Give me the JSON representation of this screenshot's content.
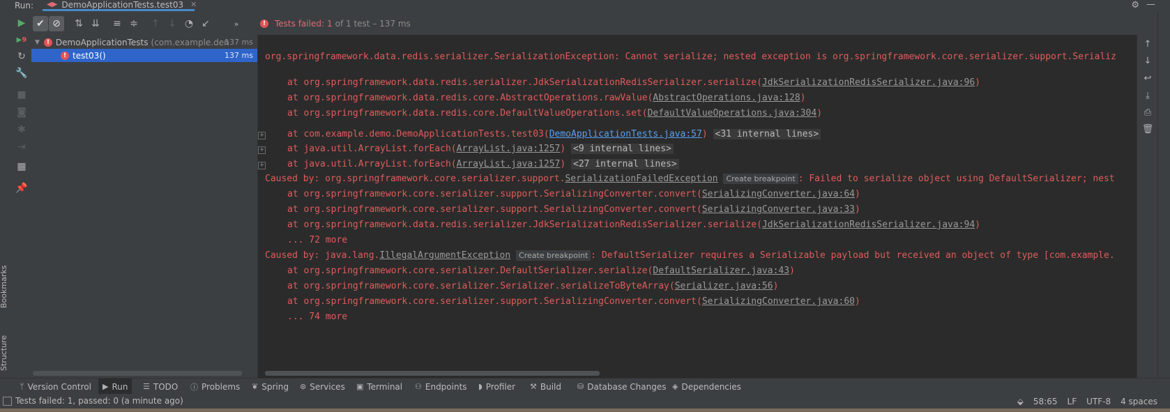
{
  "header": {
    "run_label": "Run:",
    "tab_title": "DemoApplicationTests.test03"
  },
  "status_message": {
    "prefix": "Tests failed:",
    "count": "1",
    "detail": "of 1 test – 137 ms"
  },
  "left_strip": {
    "bookmarks": "Bookmarks",
    "structure": "Structure"
  },
  "run_column": {
    "fail_count": "9"
  },
  "tree": {
    "root": {
      "name": "DemoApplicationTests",
      "package": "(com.example.den",
      "time": "137 ms"
    },
    "child": {
      "name": "test03()",
      "time": "137 ms"
    }
  },
  "console": {
    "line1": "org.springframework.data.redis.serializer.SerializationException: Cannot serialize; nested exception is org.springframework.core.serializer.support.Serializ",
    "l2_pre": "at org.springframework.data.redis.serializer.JdkSerializationRedisSerializer.serialize(",
    "l2_link": "JdkSerializationRedisSerializer.java:96",
    "l2_post": ")",
    "l3_pre": "at org.springframework.data.redis.core.AbstractOperations.rawValue(",
    "l3_link": "AbstractOperations.java:128",
    "l3_post": ")",
    "l4_pre": "at org.springframework.data.redis.core.DefaultValueOperations.set(",
    "l4_link": "DefaultValueOperations.java:304",
    "l4_post": ")",
    "l5_pre": "at com.example.demo.DemoApplicationTests.test03(",
    "l5_link": "DemoApplicationTests.java:57",
    "l5_post": ")",
    "l5_internal": "<31 internal lines>",
    "l6_pre": "at java.util.ArrayList.forEach(",
    "l6_link": "ArrayList.java:1257",
    "l6_post": ")",
    "l6_internal": "<9 internal lines>",
    "l7_pre": "at java.util.ArrayList.forEach(",
    "l7_link": "ArrayList.java:1257",
    "l7_post": ")",
    "l7_internal": "<27 internal lines>",
    "l8_pre": "Caused by: org.springframework.core.serializer.support.",
    "l8_link": "SerializationFailedException",
    "l8_bp": "Create breakpoint",
    "l8_post": ": Failed to serialize object using DefaultSerializer; nest",
    "l9_pre": "at org.springframework.core.serializer.support.SerializingConverter.convert(",
    "l9_link": "SerializingConverter.java:64",
    "l9_post": ")",
    "l10_pre": "at org.springframework.core.serializer.support.SerializingConverter.convert(",
    "l10_link": "SerializingConverter.java:33",
    "l10_post": ")",
    "l11_pre": "at org.springframework.data.redis.serializer.JdkSerializationRedisSerializer.serialize(",
    "l11_link": "JdkSerializationRedisSerializer.java:94",
    "l11_post": ")",
    "l12": "... 72 more",
    "l13_pre": "Caused by: java.lang.",
    "l13_link": "IllegalArgumentException",
    "l13_bp": "Create breakpoint",
    "l13_post": ": DefaultSerializer requires a Serializable payload but received an object of type [com.example.",
    "l14_pre": "at org.springframework.core.serializer.DefaultSerializer.serialize(",
    "l14_link": "DefaultSerializer.java:43",
    "l14_post": ")",
    "l15_pre": "at org.springframework.core.serializer.Serializer.serializeToByteArray(",
    "l15_link": "Serializer.java:56",
    "l15_post": ")",
    "l16_pre": "at org.springframework.core.serializer.support.SerializingConverter.convert(",
    "l16_link": "SerializingConverter.java:60",
    "l16_post": ")",
    "l17": "... 74 more"
  },
  "bottom_tabs": [
    "Version Control",
    "Run",
    "TODO",
    "Problems",
    "Spring",
    "Services",
    "Terminal",
    "Endpoints",
    "Profiler",
    "Build",
    "Database Changes",
    "Dependencies"
  ],
  "status_bar": {
    "text": "Tests failed: 1, passed: 0 (a minute ago)",
    "position": "58:65",
    "line_sep": "LF",
    "encoding": "UTF-8",
    "indent": "4 spaces"
  },
  "colors": {
    "error": "#e05c5c",
    "selection": "#2f65ca",
    "link": "#5a9ff0"
  }
}
